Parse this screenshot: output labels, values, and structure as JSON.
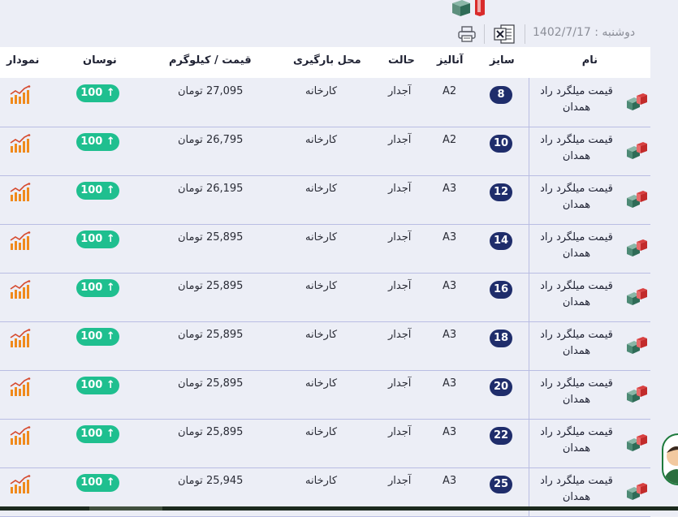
{
  "header": {
    "date": "دوشنبه : 1402/7/17",
    "icons": {
      "print": "printer-icon",
      "excel": "excel-icon"
    }
  },
  "table": {
    "columns": {
      "name": "نام",
      "size": "سایز",
      "analysis": "آنالیز",
      "state": "حالت",
      "place": "محل بارگیری",
      "price": "قیمت / کیلوگرم",
      "change": "نوسان",
      "chart": "نمودار"
    },
    "rows": [
      {
        "name": "قیمت میلگرد راد همدان",
        "size": "8",
        "analysis": "A2",
        "state": "آجدار",
        "place": "کارخانه",
        "price": "27,095 تومان",
        "change": "100 ↑"
      },
      {
        "name": "قیمت میلگرد راد همدان",
        "size": "10",
        "analysis": "A2",
        "state": "آجدار",
        "place": "کارخانه",
        "price": "26,795 تومان",
        "change": "100 ↑"
      },
      {
        "name": "قیمت میلگرد راد همدان",
        "size": "12",
        "analysis": "A3",
        "state": "آجدار",
        "place": "کارخانه",
        "price": "26,195 تومان",
        "change": "100 ↑"
      },
      {
        "name": "قیمت میلگرد راد همدان",
        "size": "14",
        "analysis": "A3",
        "state": "آجدار",
        "place": "کارخانه",
        "price": "25,895 تومان",
        "change": "100 ↑"
      },
      {
        "name": "قیمت میلگرد راد همدان",
        "size": "16",
        "analysis": "A3",
        "state": "آجدار",
        "place": "کارخانه",
        "price": "25,895 تومان",
        "change": "100 ↑"
      },
      {
        "name": "قیمت میلگرد راد همدان",
        "size": "18",
        "analysis": "A3",
        "state": "آجدار",
        "place": "کارخانه",
        "price": "25,895 تومان",
        "change": "100 ↑"
      },
      {
        "name": "قیمت میلگرد راد همدان",
        "size": "20",
        "analysis": "A3",
        "state": "آجدار",
        "place": "کارخانه",
        "price": "25,895 تومان",
        "change": "100 ↑"
      },
      {
        "name": "قیمت میلگرد راد همدان",
        "size": "22",
        "analysis": "A3",
        "state": "آجدار",
        "place": "کارخانه",
        "price": "25,895 تومان",
        "change": "100 ↑"
      },
      {
        "name": "قیمت میلگرد راد همدان",
        "size": "25",
        "analysis": "A3",
        "state": "آجدار",
        "place": "کارخانه",
        "price": "25,945 تومان",
        "change": "100 ↑"
      }
    ]
  },
  "colors": {
    "background": "#eceef6",
    "size_badge": "#1f2d6b",
    "change_up": "#1fbf8f",
    "chart_icon": "#f08a1c"
  }
}
